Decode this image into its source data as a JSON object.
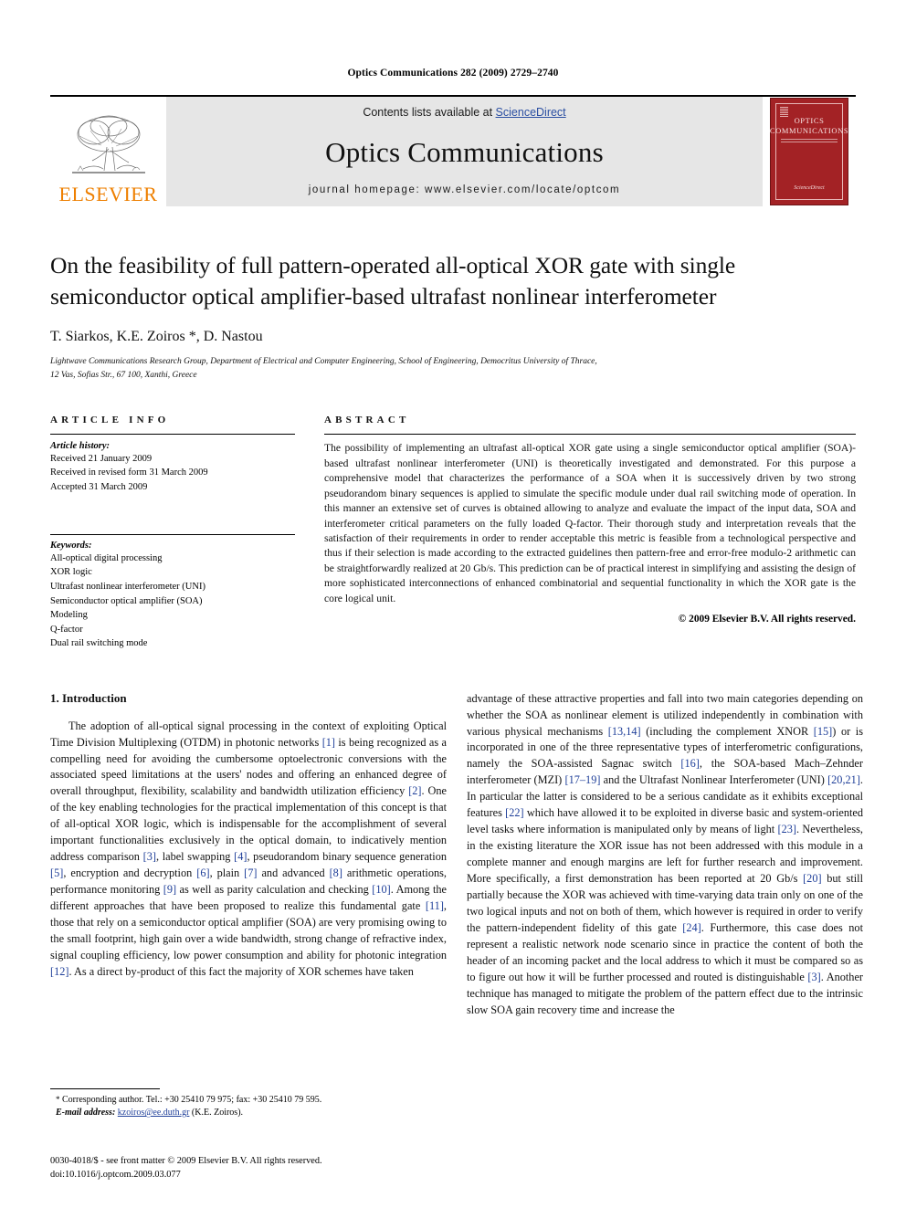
{
  "running_head": "Optics Communications 282 (2009) 2729–2740",
  "masthead": {
    "contents_prefix": "Contents lists available at ",
    "sciencedirect_label": "ScienceDirect",
    "journal_name": "Optics Communications",
    "homepage_line": "journal homepage: www.elsevier.com/locate/optcom",
    "publisher_wordmark": "ELSEVIER",
    "cover": {
      "line1": "OPTICS",
      "line2": "COMMUNICATIONS",
      "footer": "ScienceDirect"
    },
    "accent_color": "#ee7f00",
    "cover_color": "#a32225",
    "link_color": "#2b4fa2",
    "band_color": "#e6e6e6"
  },
  "article": {
    "title": "On the feasibility of full pattern-operated all-optical XOR gate with single semiconductor optical amplifier-based ultrafast nonlinear interferometer",
    "authors": "T. Siarkos, K.E. Zoiros *, D. Nastou",
    "affiliation_line1": "Lightwave Communications Research Group, Department of Electrical and Computer Engineering, School of Engineering, Democritus University of Thrace,",
    "affiliation_line2": "12 Vas, Sofias Str., 67 100, Xanthi, Greece"
  },
  "article_info": {
    "heading": "ARTICLE INFO",
    "history_heading": "Article history:",
    "history": [
      "Received 21 January 2009",
      "Received in revised form 31 March 2009",
      "Accepted 31 March 2009"
    ],
    "keywords_heading": "Keywords:",
    "keywords": [
      "All-optical digital processing",
      "XOR logic",
      "Ultrafast nonlinear interferometer (UNI)",
      "Semiconductor optical amplifier (SOA)",
      "Modeling",
      "Q-factor",
      "Dual rail switching mode"
    ]
  },
  "abstract": {
    "heading": "ABSTRACT",
    "text": "The possibility of implementing an ultrafast all-optical XOR gate using a single semiconductor optical amplifier (SOA)-based ultrafast nonlinear interferometer (UNI) is theoretically investigated and demonstrated. For this purpose a comprehensive model that characterizes the performance of a SOA when it is successively driven by two strong pseudorandom binary sequences is applied to simulate the specific module under dual rail switching mode of operation. In this manner an extensive set of curves is obtained allowing to analyze and evaluate the impact of the input data, SOA and interferometer critical parameters on the fully loaded Q-factor. Their thorough study and interpretation reveals that the satisfaction of their requirements in order to render acceptable this metric is feasible from a technological perspective and thus if their selection is made according to the extracted guidelines then pattern-free and error-free modulo-2 arithmetic can be straightforwardly realized at 20 Gb/s. This prediction can be of practical interest in simplifying and assisting the design of more sophisticated interconnections of enhanced combinatorial and sequential functionality in which the XOR gate is the core logical unit.",
    "copyright": "© 2009 Elsevier B.V. All rights reserved."
  },
  "introduction": {
    "heading": "1. Introduction",
    "left_paragraph_html": "The adoption of all-optical signal processing in the context of exploiting Optical Time Division Multiplexing (OTDM) in photonic networks <span class=\"ref\">[1]</span> is being recognized as a compelling need for avoiding the cumbersome optoelectronic conversions with the associated speed limitations at the users' nodes and offering an enhanced degree of overall throughput, flexibility, scalability and bandwidth utilization efficiency <span class=\"ref\">[2]</span>. One of the key enabling technologies for the practical implementation of this concept is that of all-optical XOR logic, which is indispensable for the accomplishment of several important functionalities exclusively in the optical domain, to indicatively mention address comparison <span class=\"ref\">[3]</span>, label swapping <span class=\"ref\">[4]</span>, pseudorandom binary sequence generation <span class=\"ref\">[5]</span>, encryption and decryption <span class=\"ref\">[6]</span>, plain <span class=\"ref\">[7]</span> and advanced <span class=\"ref\">[8]</span> arithmetic operations, performance monitoring <span class=\"ref\">[9]</span> as well as parity calculation and checking <span class=\"ref\">[10]</span>. Among the different approaches that have been proposed to realize this fundamental gate <span class=\"ref\">[11]</span>, those that rely on a semiconductor optical amplifier (SOA) are very promising owing to the small footprint, high gain over a wide bandwidth, strong change of refractive index, signal coupling efficiency, low power consumption and ability for photonic integration <span class=\"ref\">[12]</span>. As a direct by-product of this fact the majority of XOR schemes have taken",
    "right_paragraph_html": "advantage of these attractive properties and fall into two main categories depending on whether the SOA as nonlinear element is utilized independently in combination with various physical mechanisms <span class=\"ref\">[13,14]</span> (including the complement XNOR <span class=\"ref\">[15]</span>) or is incorporated in one of the three representative types of interferometric configurations, namely the SOA-assisted Sagnac switch <span class=\"ref\">[16]</span>, the SOA-based Mach–Zehnder interferometer (MZI) <span class=\"ref\">[17–19]</span> and the Ultrafast Nonlinear Interferometer (UNI) <span class=\"ref\">[20,21]</span>. In particular the latter is considered to be a serious candidate as it exhibits exceptional features <span class=\"ref\">[22]</span> which have allowed it to be exploited in diverse basic and system-oriented level tasks where information is manipulated only by means of light <span class=\"ref\">[23]</span>. Nevertheless, in the existing literature the XOR issue has not been addressed with this module in a complete manner and enough margins are left for further research and improvement. More specifically, a first demonstration has been reported at 20 Gb/s <span class=\"ref\">[20]</span> but still partially because the XOR was achieved with time-varying data train only on one of the two logical inputs and not on both of them, which however is required in order to verify the pattern-independent fidelity of this gate <span class=\"ref\">[24]</span>. Furthermore, this case does not represent a realistic network node scenario since in practice the content of both the header of an incoming packet and the local address to which it must be compared so as to figure out how it will be further processed and routed is distinguishable <span class=\"ref\">[3]</span>. Another technique has managed to mitigate the problem of the pattern effect due to the intrinsic slow SOA gain recovery time and increase the"
  },
  "footnote": {
    "marker": "*",
    "line1": "Corresponding author. Tel.: +30 25410 79 975; fax: +30 25410 79 595.",
    "email_label": "E-mail address:",
    "email": "kzoiros@ee.duth.gr",
    "email_owner": "(K.E. Zoiros)."
  },
  "page_footer": {
    "line1": "0030-4018/$ - see front matter © 2009 Elsevier B.V. All rights reserved.",
    "line2": "doi:10.1016/j.optcom.2009.03.077"
  }
}
